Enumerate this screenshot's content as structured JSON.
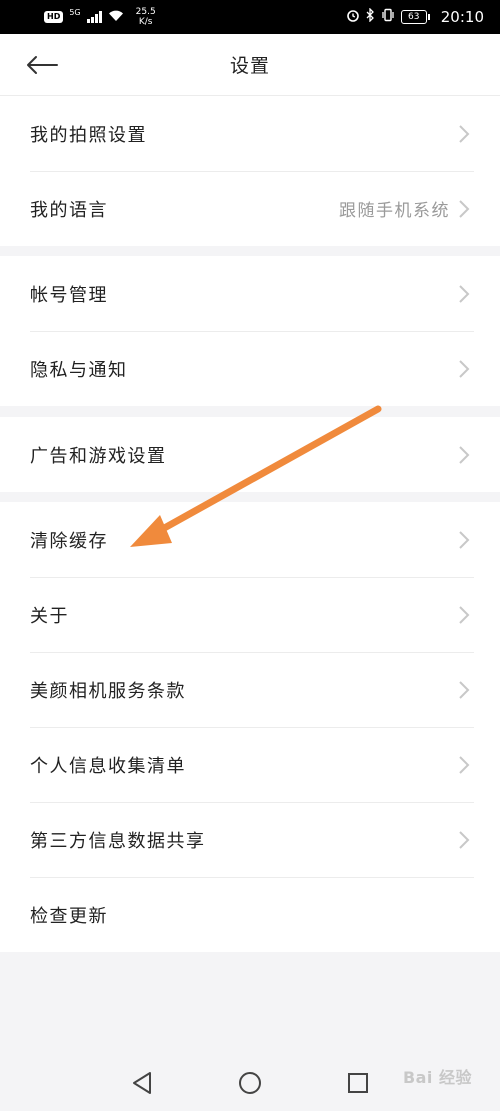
{
  "status_bar": {
    "hd": "HD",
    "network": "5G",
    "speed_value": "25.5",
    "speed_unit": "K/s",
    "battery": "63",
    "time": "20:10"
  },
  "header": {
    "title": "设置"
  },
  "groups": [
    {
      "items": [
        {
          "label": "我的拍照设置"
        },
        {
          "label": "我的语言",
          "value": "跟随手机系统"
        }
      ]
    },
    {
      "items": [
        {
          "label": "帐号管理"
        },
        {
          "label": "隐私与通知"
        }
      ]
    },
    {
      "items": [
        {
          "label": "广告和游戏设置"
        }
      ]
    },
    {
      "items": [
        {
          "label": "清除缓存"
        },
        {
          "label": "关于"
        },
        {
          "label": "美颜相机服务条款"
        },
        {
          "label": "个人信息收集清单"
        },
        {
          "label": "第三方信息数据共享"
        },
        {
          "label": "检查更新"
        }
      ]
    }
  ],
  "annotation": {
    "color": "#f08a3c"
  },
  "watermark": "Bai 经验",
  "colors": {
    "chevron": "#c8c8c8",
    "value_text": "#9a9a9a"
  }
}
